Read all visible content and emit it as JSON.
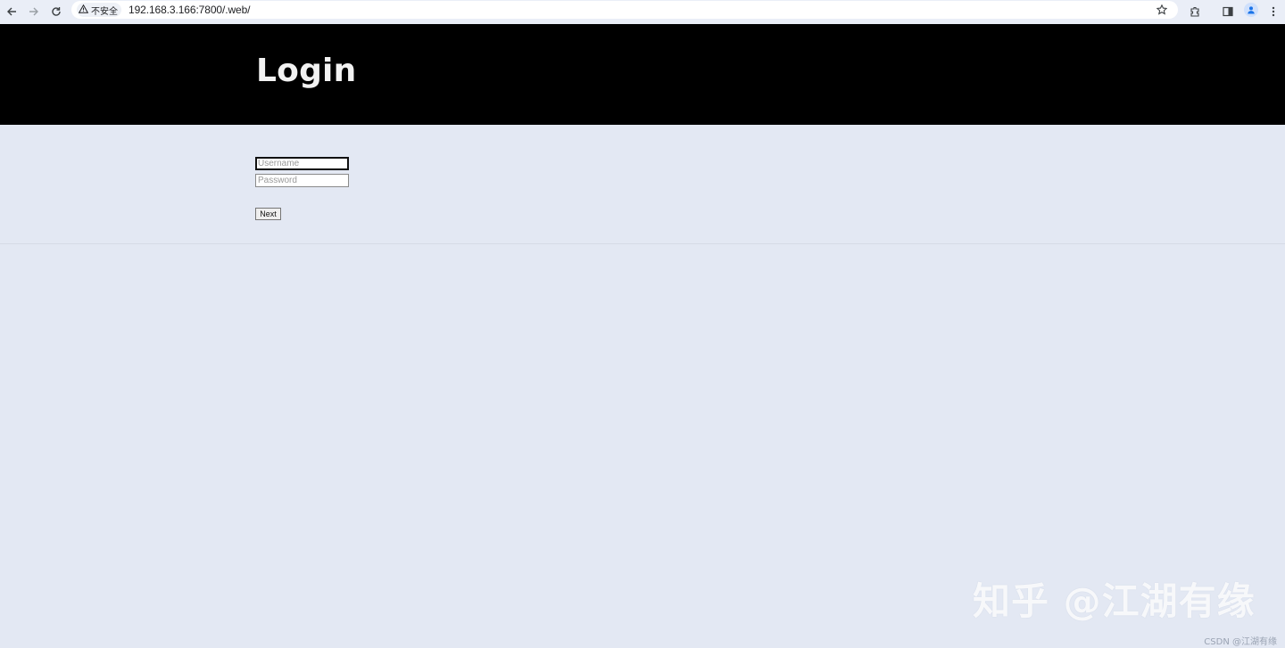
{
  "browser": {
    "security_label": "不安全",
    "url": "192.168.3.166:7800/.web/",
    "icons": [
      "back-icon",
      "forward-icon",
      "reload-icon",
      "warning-icon",
      "star-icon",
      "extensions-icon",
      "side-panel-icon",
      "profile-icon",
      "menu-icon"
    ]
  },
  "page": {
    "title": "Login",
    "username_placeholder": "Username",
    "password_placeholder": "Password",
    "next_label": "Next"
  },
  "watermark": {
    "text": "知乎 @江湖有缘",
    "credit": "CSDN @江湖有缘"
  }
}
